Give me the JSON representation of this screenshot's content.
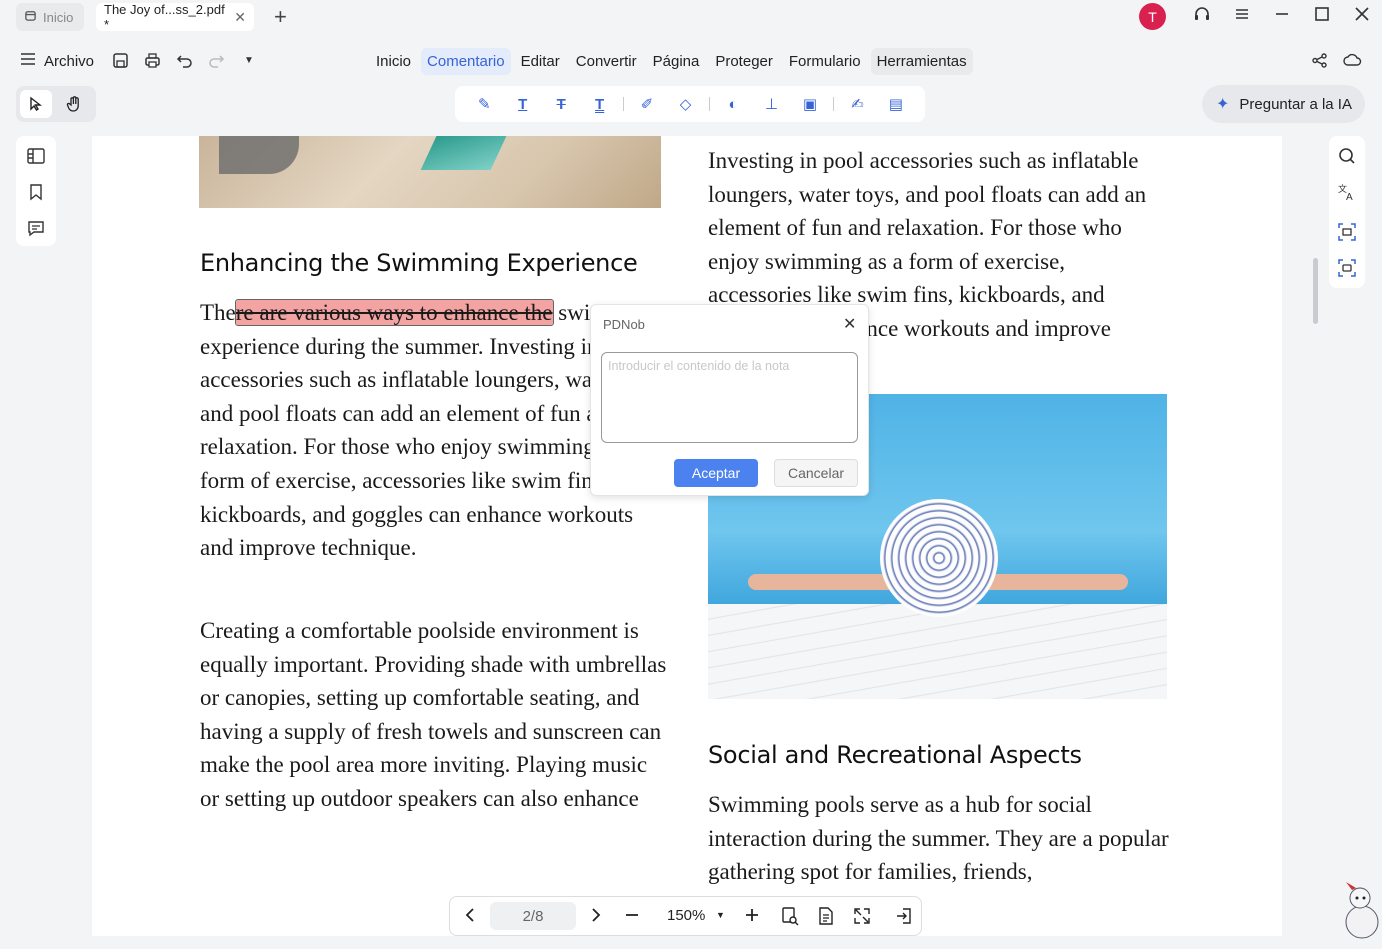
{
  "tabs": [
    {
      "label": "Inicio",
      "icon": "home-icon"
    },
    {
      "label": "The Joy of...ss_2.pdf *",
      "icon": "close-icon"
    }
  ],
  "avatar_initial": "T",
  "menu": {
    "archivo": "Archivo",
    "items": [
      "Inicio",
      "Comentario",
      "Editar",
      "Convertir",
      "Página",
      "Proteger",
      "Formulario",
      "Herramientas"
    ],
    "active": "Comentario"
  },
  "ask_ai": "Preguntar a la IA",
  "document": {
    "heading_left": "Enhancing the Swimming Experience",
    "para1_start": "The",
    "para1_highlight": "re are various ways to enhance the",
    "para1_rest": "swimming experience during the summer. Investing in pool accessories such as inflatable loungers, water toys, and pool floats can add an element of fun and relaxation. For those who enjoy swimming as a form of exercise, accessories like swim fins, kickboards, and goggles can enhance workouts and improve technique.",
    "para2": "Creating a comfortable poolside environment is equally important. Providing shade with umbrellas or canopies, setting up comfortable seating, and having a supply of fresh towels and sunscreen can make the pool area more inviting. Playing music or setting up outdoor speakers can also enhance",
    "right_para": "Investing in pool accessories such as inflatable loungers, water toys, and pool floats can add an element of fun and relaxation. For those who enjoy swimming as a form of exercise, accessories like swim fins, kickboards, and goggles can enhance workouts and improve technique.",
    "heading_right": "Social and Recreational Aspects",
    "right_para2": "Swimming pools serve as a hub for social interaction during the summer. They are a popular gathering spot for families, friends,"
  },
  "popup": {
    "title": "PDNob",
    "placeholder": "Introducir el contenido de la nota",
    "accept": "Aceptar",
    "cancel": "Cancelar"
  },
  "navigation": {
    "page": "2/8",
    "zoom": "150%"
  }
}
